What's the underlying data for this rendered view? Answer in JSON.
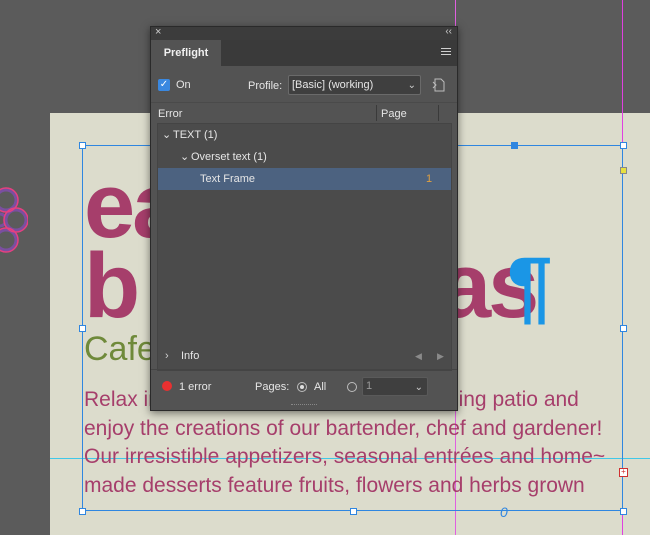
{
  "document": {
    "headline_line1": "ea",
    "headline_line2": "b",
    "headline_line2_end": "as",
    "pilcrow": "¶",
    "subtitle": "Cafe",
    "body_lines": [
      "Relax in                                             arming patio and",
      "enjoy the creations of our bartender, chef and gardener!",
      "Our irresistible appetizers, seasonal entrées and home~",
      "made desserts feature fruits, flowers and herbs grown"
    ],
    "overset_marker": "0"
  },
  "panel": {
    "close_glyph": "×",
    "collapse_glyph": "‹‹",
    "tab_label": "Preflight",
    "on_label": "On",
    "on_checked": true,
    "profile_label": "Profile:",
    "profile_value": "[Basic] (working)",
    "col_error": "Error",
    "col_page": "Page",
    "rows": [
      {
        "label": "TEXT (1)",
        "page": ""
      },
      {
        "label": "Overset text (1)",
        "page": ""
      },
      {
        "label": "Text Frame",
        "page": "1"
      }
    ],
    "info_label": "Info",
    "error_count": "1 error",
    "pages_label": "Pages:",
    "all_label": "All",
    "page_range_value": "1"
  },
  "colors": {
    "accent": "#3a88e0",
    "selection": "#4c6280",
    "error": "#e83030",
    "magenta_text": "#a63e6b",
    "green_text": "#6f8a3a"
  }
}
